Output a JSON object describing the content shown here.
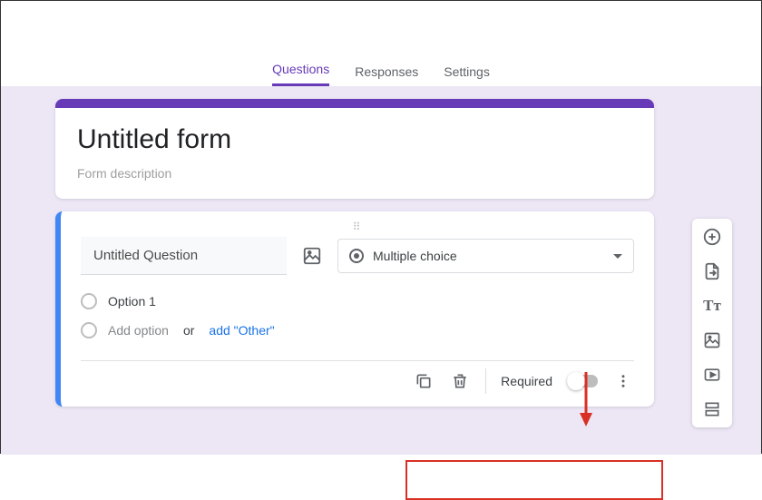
{
  "tabs": {
    "questions": "Questions",
    "responses": "Responses",
    "settings": "Settings"
  },
  "form": {
    "title": "Untitled form",
    "description": "Form description"
  },
  "question": {
    "title": "Untitled Question",
    "type_label": "Multiple choice",
    "option1": "Option 1",
    "add_option": "Add option",
    "or": "or",
    "add_other": "add \"Other\""
  },
  "footer": {
    "required_label": "Required"
  },
  "toolbar": {
    "add_question": "add",
    "import": "import",
    "title_desc": "title",
    "image": "image",
    "video": "video",
    "section": "section"
  }
}
